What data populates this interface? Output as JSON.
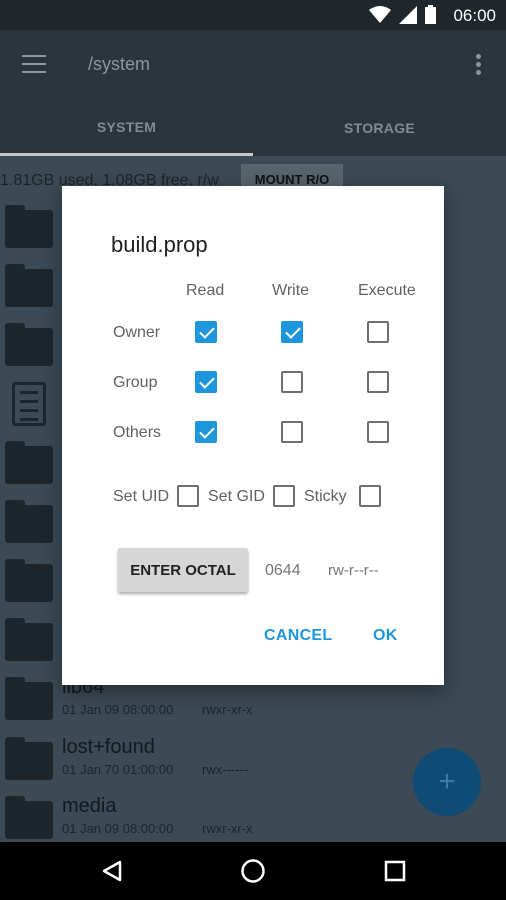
{
  "status_bar": {
    "time": "06:00",
    "icons": [
      "wifi-icon",
      "signal-icon",
      "battery-icon"
    ]
  },
  "app_bar": {
    "path": "/system"
  },
  "tabs": [
    {
      "label": "SYSTEM"
    },
    {
      "label": "STORAGE"
    }
  ],
  "storage": {
    "usage": "1.81GB used, 1.08GB free, r/w",
    "mount_button": "MOUNT R/O"
  },
  "files": [
    {
      "name": "lib64",
      "date": "01 Jan 09 08:00:00",
      "perm": "rwxr-xr-x"
    },
    {
      "name": "lost+found",
      "date": "01 Jan 70 01:00:00",
      "perm": "rwx------"
    },
    {
      "name": "media",
      "date": "01 Jan 09 08:00:00",
      "perm": "rwxr-xr-x"
    }
  ],
  "dialog": {
    "title": "build.prop",
    "columns": {
      "read": "Read",
      "write": "Write",
      "execute": "Execute"
    },
    "rows": {
      "owner": "Owner",
      "group": "Group",
      "others": "Others"
    },
    "special": {
      "set_uid": "Set UID",
      "set_gid": "Set GID",
      "sticky": "Sticky"
    },
    "enter_octal": "ENTER OCTAL",
    "octal_value": "0644",
    "octal_perm": "rw-r--r--",
    "cancel": "CANCEL",
    "ok": "OK"
  },
  "colors": {
    "accent": "#1e96dc",
    "toolbar": "#2b353d",
    "scrim": "#3c4a55"
  }
}
